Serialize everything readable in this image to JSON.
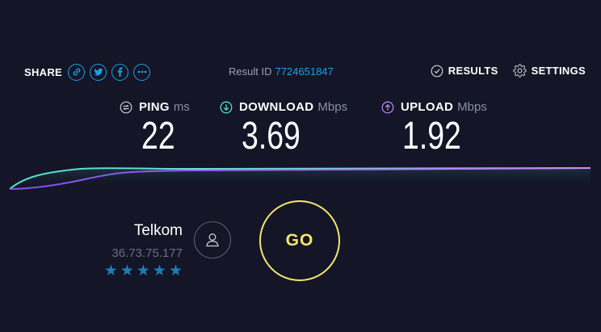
{
  "share": {
    "label": "SHARE",
    "buttons": [
      "link-icon",
      "twitter-icon",
      "facebook-icon",
      "more-icon"
    ]
  },
  "result": {
    "label": "Result ID",
    "id": "7724651847"
  },
  "nav": {
    "results_label": "RESULTS",
    "settings_label": "SETTINGS"
  },
  "metrics": {
    "ping": {
      "name": "PING",
      "unit": "ms",
      "value": "22",
      "icon": "ping-icon"
    },
    "download": {
      "name": "DOWNLOAD",
      "unit": "Mbps",
      "value": "3.69",
      "icon": "download-arrow-icon"
    },
    "upload": {
      "name": "UPLOAD",
      "unit": "Mbps",
      "value": "1.92",
      "icon": "upload-arrow-icon"
    }
  },
  "isp": {
    "name": "Telkom",
    "ip": "36.73.75.177",
    "rating_stars": 5
  },
  "go_label": "GO",
  "colors": {
    "background": "#141526",
    "accent_blue": "#1ea0e6",
    "download_teal": "#4fe0cf",
    "upload_purple": "#9b6bf0",
    "go_yellow": "#f3e66f"
  }
}
